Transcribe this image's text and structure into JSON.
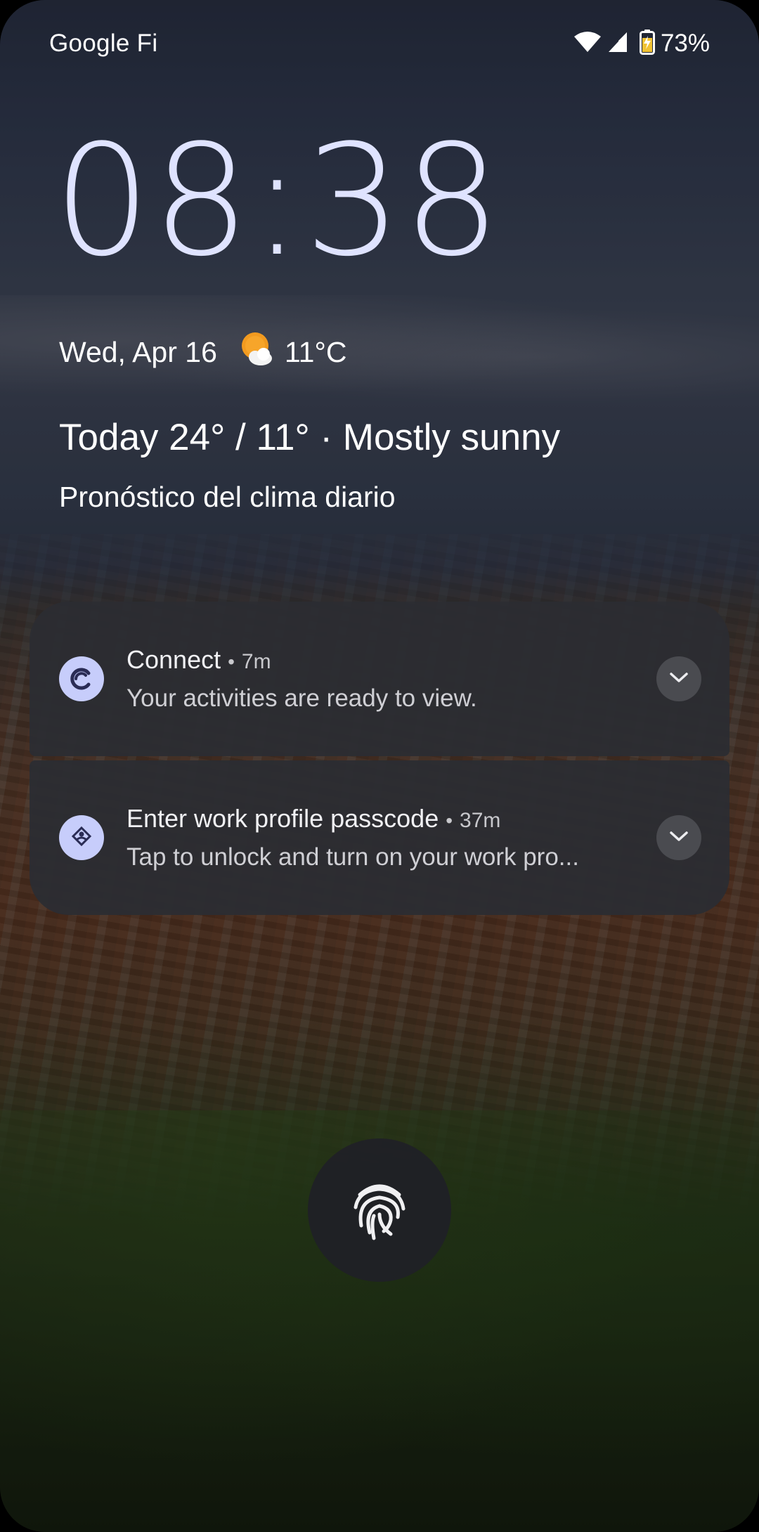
{
  "status_bar": {
    "carrier": "Google Fi",
    "battery_percent": "73%",
    "icons": [
      "wifi-icon",
      "cell-signal-icon",
      "battery-charging-icon"
    ]
  },
  "lockscreen": {
    "clock": "08:38",
    "date": "Wed, Apr 16",
    "weather_icon": "partly-sunny-icon",
    "temperature": "11°C",
    "forecast": "Today 24° / 11° · Mostly sunny",
    "forecast_subtitle": "Pronóstico del clima diario"
  },
  "notifications": [
    {
      "app_icon": "connect-app-icon",
      "title": "Connect",
      "time": "7m",
      "body": "Your activities are ready to view."
    },
    {
      "app_icon": "work-profile-icon",
      "title": "Enter work profile passcode",
      "time": "37m",
      "body": "Tap to unlock and turn on your work pro..."
    }
  ],
  "unlock": {
    "icon": "fingerprint-icon"
  },
  "colors": {
    "clock": "#dfe3ff",
    "notification_bg": "#2c2d32",
    "app_icon_bg": "#c7cdfb",
    "weather_sun": "#f29a1f"
  }
}
